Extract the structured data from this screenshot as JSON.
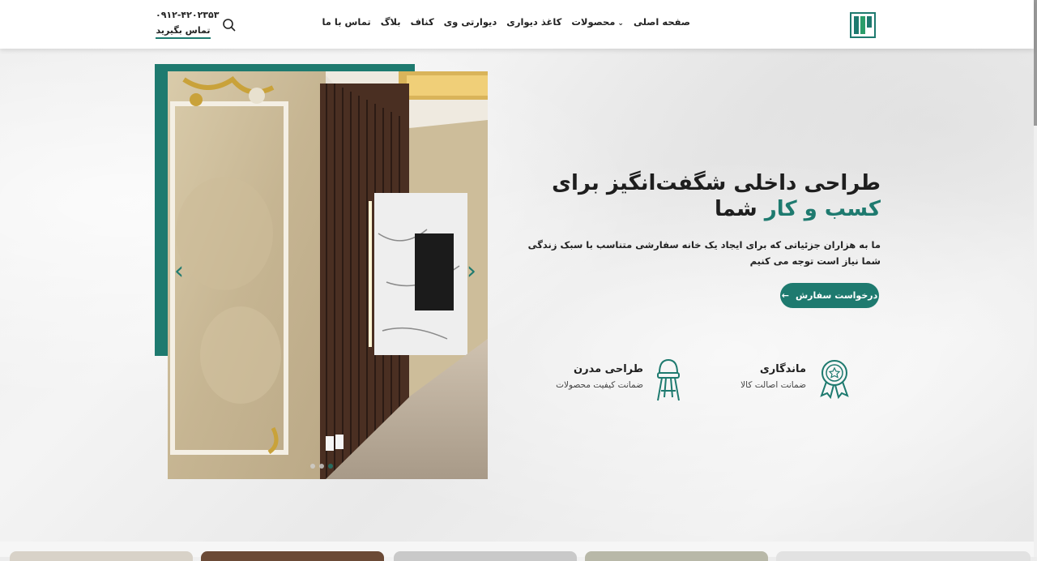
{
  "header": {
    "nav": [
      "صفحه اصلی",
      "محصولات",
      "کاغذ دیواری",
      "دیوارتی وی",
      "کناف",
      "بلاگ",
      "تماس با ما"
    ],
    "phone": "۰۹۱۲-۴۲۰۲۳۵۳",
    "contact_label": "تماس بگیرید"
  },
  "hero": {
    "title_line1": "طراحی داخلی شگفت‌انگیز برای",
    "title_accent": "کسب و کار",
    "title_rest": "شما",
    "description": "ما به هزاران جزئیاتی که برای ایجاد یک خانه سفارشی متناسب با سبک زندگی شما نیاز است توجه می کنیم",
    "cta_label": "درخواست سفارش"
  },
  "features": [
    {
      "title": "ماندگاری",
      "subtitle": "ضمانت اصالت کالا",
      "icon": "award-badge-icon"
    },
    {
      "title": "طراحی مدرن",
      "subtitle": "ضمانت کیفیت محصولات",
      "icon": "chair-icon"
    }
  ],
  "slider": {
    "active_slide": 3,
    "total_slides": 3
  },
  "colors": {
    "accent": "#1e7a6f",
    "text": "#1e1e1e"
  }
}
